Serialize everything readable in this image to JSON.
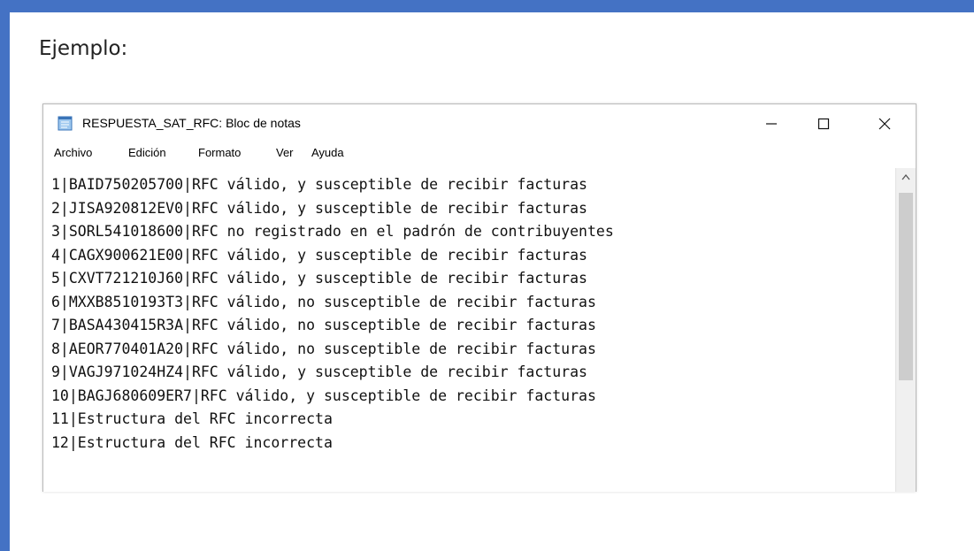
{
  "caption": "Ejemplo:",
  "window": {
    "title": "RESPUESTA_SAT_RFC: Bloc de notas",
    "icon": "notepad-icon",
    "controls": {
      "minimize_icon": "minimize-icon",
      "maximize_icon": "maximize-icon",
      "close_icon": "close-icon"
    }
  },
  "menu": [
    "Archivo",
    "Edición",
    "Formato",
    "Ver",
    "Ayuda"
  ],
  "lines": [
    "1|BAID750205700|RFC válido, y susceptible de recibir facturas",
    "2|JISA920812EV0|RFC válido, y susceptible de recibir facturas",
    "3|SORL541018600|RFC no registrado en el padrón de contribuyentes",
    "4|CAGX900621E00|RFC válido, y susceptible de recibir facturas",
    "5|CXVT721210J60|RFC válido, y susceptible de recibir facturas",
    "6|MXXB8510193T3|RFC válido, no susceptible de recibir facturas",
    "7|BASA430415R3A|RFC válido, no susceptible de recibir facturas",
    "8|AEOR770401A20|RFC válido, no susceptible de recibir facturas",
    "9|VAGJ971024HZ4|RFC válido, y susceptible de recibir facturas",
    "10|BAGJ680609ER7|RFC válido, y susceptible de recibir facturas",
    "11|Estructura del RFC incorrecta",
    "12|Estructura del RFC incorrecta"
  ],
  "colors": {
    "frame_accent": "#4472c4",
    "scroll_thumb": "#cdcdcd",
    "scroll_track": "#f0f0f0"
  }
}
